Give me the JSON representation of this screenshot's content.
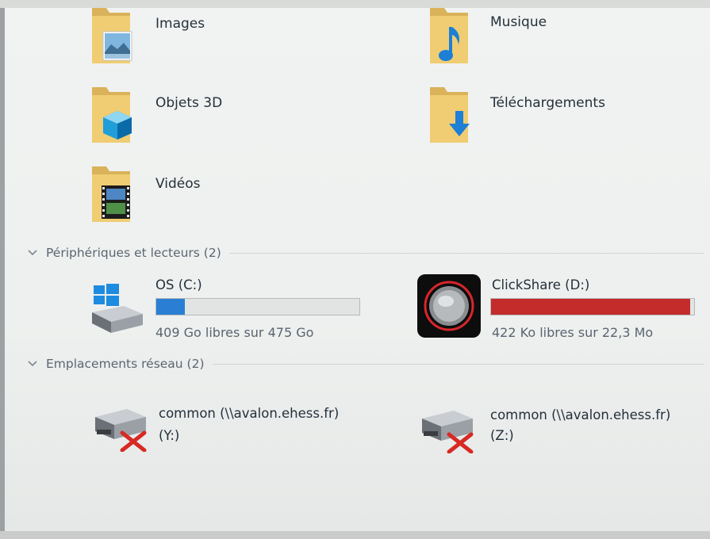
{
  "folders": [
    {
      "label": "Images",
      "icon": "images-folder-icon"
    },
    {
      "label": "Musique",
      "icon": "music-folder-icon"
    },
    {
      "label": "Objets 3D",
      "icon": "objects-3d-folder-icon"
    },
    {
      "label": "Téléchargements",
      "icon": "downloads-folder-icon"
    },
    {
      "label": "Vidéos",
      "icon": "videos-folder-icon"
    }
  ],
  "devices_section": {
    "title": "Périphériques et lecteurs (2)",
    "drives": [
      {
        "name": "OS (C:)",
        "space_text": "409 Go libres sur 475 Go",
        "used_fraction": 0.139,
        "bar_color": "#2a7fd4",
        "icon": "windows-drive-icon"
      },
      {
        "name": "ClickShare (D:)",
        "space_text": "422 Ko libres sur 22,3 Mo",
        "used_fraction": 0.982,
        "bar_color": "#c42b2b",
        "icon": "clickshare-drive-icon"
      }
    ]
  },
  "network_section": {
    "title": "Emplacements réseau (2)",
    "locations": [
      {
        "name": "common (\\\\avalon.ehess.fr)",
        "letter": "(Y:)",
        "icon": "disconnected-network-drive-icon"
      },
      {
        "name": "common (\\\\avalon.ehess.fr)",
        "letter": "(Z:)",
        "icon": "disconnected-network-drive-icon"
      }
    ]
  },
  "colors": {
    "accent_blue": "#2a7fd4",
    "warning_red": "#c42b2b",
    "folder_yellow": "#e8c56b"
  }
}
